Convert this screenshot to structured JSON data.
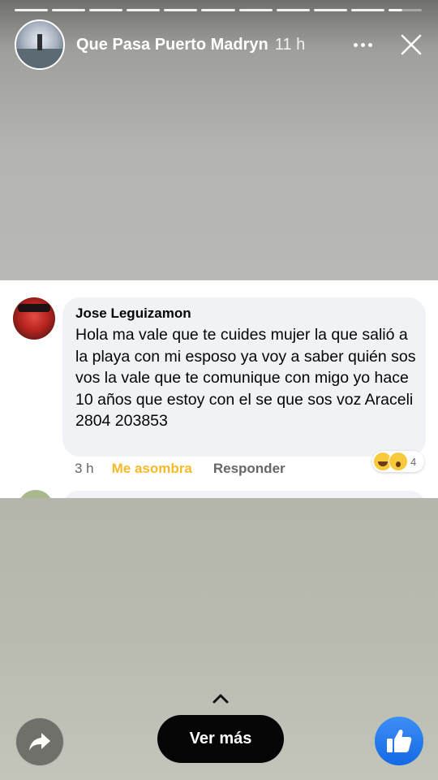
{
  "story": {
    "segments": 11,
    "page_name": "Que Pasa Puerto Madryn",
    "time_ago": "11 h"
  },
  "comment": {
    "author": "Jose Leguizamon",
    "text": "Hola ma vale que te cuides mujer la que salió a la playa con mi esposo ya voy a saber quién sos vos la vale que te comunique con migo yo hace 10 años que estoy con el se que sos voz Araceli 2804 203853",
    "time_ago": "3 h",
    "reaction_label": "Me asombra",
    "reply_label": "Responder",
    "reaction_count": "4"
  },
  "footer": {
    "see_more_label": "Ver más"
  },
  "colors": {
    "like_blue": "#1877f2",
    "wow_yellow": "#f7b928",
    "bubble_gray": "#f0f2f5"
  }
}
